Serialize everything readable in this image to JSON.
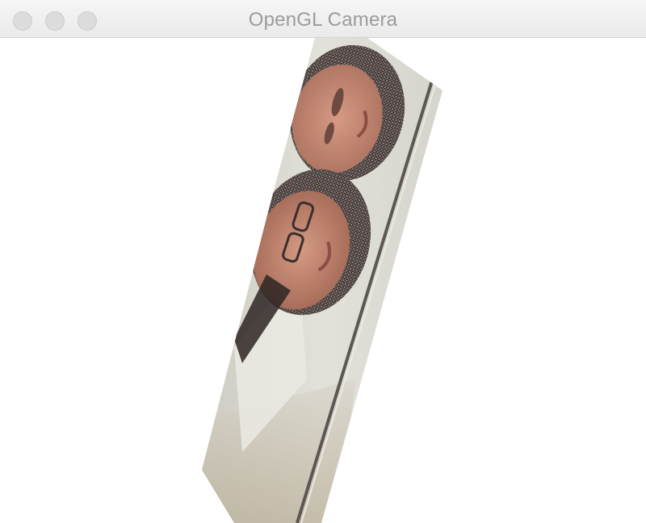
{
  "window": {
    "title": "OpenGL Camera"
  },
  "colors": {
    "titlebar": "#ececec",
    "title_text": "#9b9b9b",
    "traffic_light_inactive": "#dcdcdc",
    "canvas_background": "#ffffff"
  },
  "icons": {
    "close": "close-icon",
    "minimize": "minimize-icon",
    "zoom": "zoom-icon"
  }
}
